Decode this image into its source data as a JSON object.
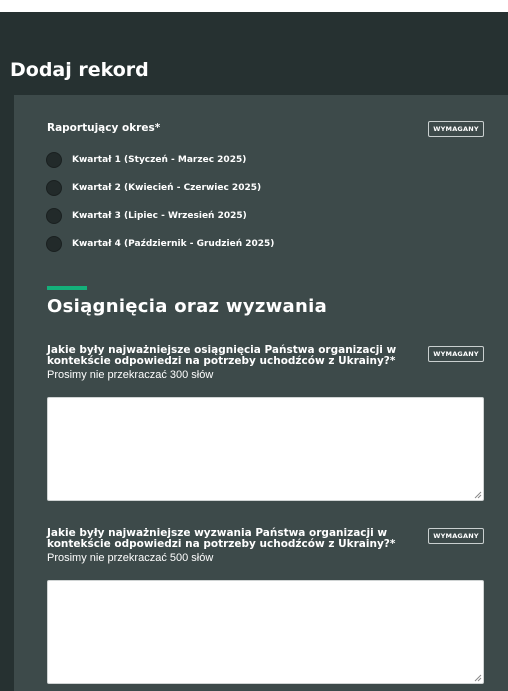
{
  "header": {
    "title": "Dodaj rekord"
  },
  "required_badge": "WYMAGANY",
  "reporting_period": {
    "label": "Raportujący okres*",
    "options": [
      "Kwartał 1 (Styczeń - Marzec 2025)",
      "Kwartał 2 (Kwiecień - Czerwiec 2025)",
      "Kwartał 3 (Lipiec - Wrzesień 2025)",
      "Kwartał 4 (Październik - Grudzień 2025)"
    ],
    "selected": null
  },
  "section": {
    "title": "Osiągnięcia oraz wyzwania"
  },
  "achievements": {
    "question_line1": "Jakie były najważniejsze osiągnięcia Państwa organizacji w",
    "question_line2": "kontekście odpowiedzi na potrzeby uchodźców z Ukrainy?*",
    "hint": "Prosimy nie przekraczać 300 słów",
    "value": ""
  },
  "challenges": {
    "question_line1": "Jakie były najważniejsze wyzwania Państwa organizacji w",
    "question_line2": "kontekście odpowiedzi na potrzeby uchodźców z Ukrainy?*",
    "hint": "Prosimy nie przekraczać 500 słów",
    "value": ""
  },
  "colors": {
    "header_bg": "#263131",
    "panel_bg": "#3d4a4a",
    "accent": "#14b07a",
    "radio_fill": "#222a2a",
    "textarea_bg": "#ffffff"
  }
}
